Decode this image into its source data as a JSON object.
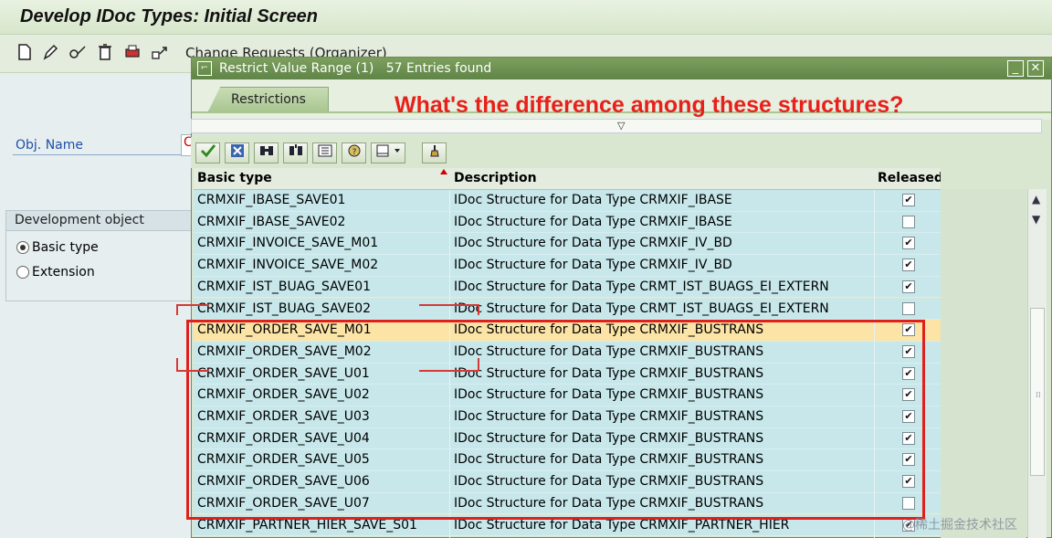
{
  "window": {
    "title": "Develop IDoc Types: Initial Screen"
  },
  "toolbar": {
    "icons": [
      "create-icon",
      "change-icon",
      "display-icon",
      "delete-icon",
      "print-icon",
      "transport-icon"
    ],
    "change_requests_label": "Change Requests (Organizer)"
  },
  "left": {
    "obj_name_label": "Obj. Name",
    "obj_name_value": "C",
    "dev_object_title": "Development object",
    "radio_basic": "Basic type",
    "radio_extension": "Extension",
    "selected": "Basic type"
  },
  "popup": {
    "title": "Restrict Value Range (1)",
    "entries_found": "57 Entries found",
    "tab_label": "Restrictions",
    "columns": {
      "basic_type": "Basic type",
      "description": "Description",
      "released": "Released"
    },
    "rows": [
      {
        "basic_type": "CRMXIF_IBASE_SAVE01",
        "description": "IDoc Structure for Data Type CRMXIF_IBASE",
        "released": true
      },
      {
        "basic_type": "CRMXIF_IBASE_SAVE02",
        "description": "IDoc Structure for Data Type CRMXIF_IBASE",
        "released": false
      },
      {
        "basic_type": "CRMXIF_INVOICE_SAVE_M01",
        "description": "IDoc Structure for Data Type CRMXIF_IV_BD",
        "released": true
      },
      {
        "basic_type": "CRMXIF_INVOICE_SAVE_M02",
        "description": "IDoc Structure for Data Type CRMXIF_IV_BD",
        "released": true
      },
      {
        "basic_type": "CRMXIF_IST_BUAG_SAVE01",
        "description": "IDoc Structure for Data Type CRMT_IST_BUAGS_EI_EXTERN",
        "released": true
      },
      {
        "basic_type": "CRMXIF_IST_BUAG_SAVE02",
        "description": "IDoc Structure for Data Type CRMT_IST_BUAGS_EI_EXTERN",
        "released": false
      },
      {
        "basic_type": "CRMXIF_ORDER_SAVE_M01",
        "description": "IDoc Structure for Data Type CRMXIF_BUSTRANS",
        "released": true,
        "selected": true
      },
      {
        "basic_type": "CRMXIF_ORDER_SAVE_M02",
        "description": "IDoc Structure for Data Type CRMXIF_BUSTRANS",
        "released": true
      },
      {
        "basic_type": "CRMXIF_ORDER_SAVE_U01",
        "description": "IDoc Structure for Data Type CRMXIF_BUSTRANS",
        "released": true
      },
      {
        "basic_type": "CRMXIF_ORDER_SAVE_U02",
        "description": "IDoc Structure for Data Type CRMXIF_BUSTRANS",
        "released": true
      },
      {
        "basic_type": "CRMXIF_ORDER_SAVE_U03",
        "description": "IDoc Structure for Data Type CRMXIF_BUSTRANS",
        "released": true
      },
      {
        "basic_type": "CRMXIF_ORDER_SAVE_U04",
        "description": "IDoc Structure for Data Type CRMXIF_BUSTRANS",
        "released": true
      },
      {
        "basic_type": "CRMXIF_ORDER_SAVE_U05",
        "description": "IDoc Structure for Data Type CRMXIF_BUSTRANS",
        "released": true
      },
      {
        "basic_type": "CRMXIF_ORDER_SAVE_U06",
        "description": "IDoc Structure for Data Type CRMXIF_BUSTRANS",
        "released": true
      },
      {
        "basic_type": "CRMXIF_ORDER_SAVE_U07",
        "description": "IDoc Structure for Data Type CRMXIF_BUSTRANS",
        "released": false
      },
      {
        "basic_type": "CRMXIF_PARTNER_HIER_SAVE_S01",
        "description": "IDoc Structure for Data Type CRMXIF_PARTNER_HIER",
        "released": true
      }
    ]
  },
  "annotation": {
    "text": "What's the difference among these structures?",
    "color": "#e8201a"
  },
  "watermark": "@稀土掘金技术社区",
  "colors": {
    "row_bg": "#c7e7ea",
    "selected_row_bg": "#fbe4a6",
    "popup_title_bg": "#6b8f50"
  }
}
